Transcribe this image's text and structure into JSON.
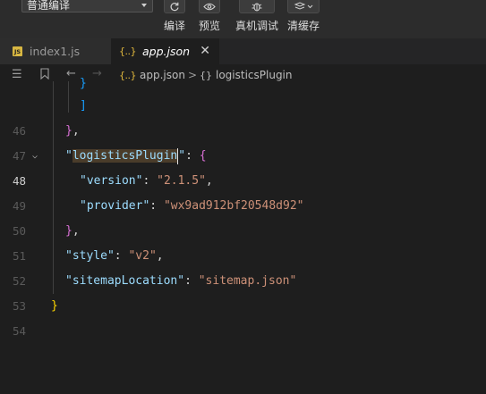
{
  "toolbar": {
    "compile_mode": "普通编译",
    "buttons": [
      {
        "label": "编译",
        "icon": "refresh-icon"
      },
      {
        "label": "预览",
        "icon": "eye-icon"
      },
      {
        "label": "真机调试",
        "icon": "bug-icon"
      },
      {
        "label": "清缓存",
        "icon": "layers-icon"
      }
    ]
  },
  "tabs": [
    {
      "label": "index1.js",
      "type": "js",
      "active": false
    },
    {
      "label": "app.json",
      "type": "json",
      "active": true
    }
  ],
  "breadcrumb": {
    "file": "app.json",
    "separator": ">",
    "object_icon": "{}",
    "node": "logisticsPlugin"
  },
  "editor": {
    "lines": [
      {
        "num": "",
        "text": "}"
      },
      {
        "num": "46",
        "text": "]"
      },
      {
        "num": "47",
        "text": "},"
      },
      {
        "num": "48",
        "text": "\"logisticsPlugin\": {"
      },
      {
        "num": "49",
        "text": "\"version\": \"2.1.5\","
      },
      {
        "num": "50",
        "text": "\"provider\": \"wx9ad912bf20548d92\""
      },
      {
        "num": "51",
        "text": "},"
      },
      {
        "num": "52",
        "text": "\"style\": \"v2\","
      },
      {
        "num": "53",
        "text": "\"sitemapLocation\": \"sitemap.json\""
      },
      {
        "num": "54",
        "text": "}"
      }
    ],
    "current_line": "48",
    "tokens": {
      "key_logistics": "logisticsPlugin",
      "key_version": "version",
      "val_version": "2.1.5",
      "key_provider": "provider",
      "val_provider": "wx9ad912bf20548d92",
      "key_style": "style",
      "val_style": "v2",
      "key_sitemap": "sitemapLocation",
      "val_sitemap": "sitemap.json"
    }
  },
  "colors": {
    "background": "#1e1e1e",
    "key": "#9cdcfe",
    "string": "#ce9178",
    "bracket_gold": "#ffd700",
    "bracket_purple": "#da70d6",
    "bracket_blue": "#179fff",
    "json_icon": "#e2b93d",
    "js_badge": "#d8b742"
  }
}
